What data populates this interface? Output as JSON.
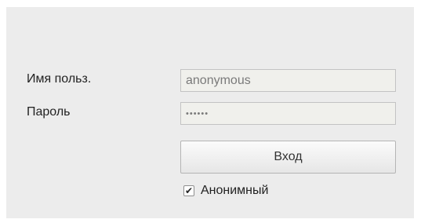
{
  "login_form": {
    "username_label": "Имя польз.",
    "username_value": "anonymous",
    "password_label": "Пароль",
    "password_value": "••••••",
    "login_button_label": "Вход",
    "anonymous_checkbox": {
      "label": "Анонимный",
      "checked": true,
      "check_glyph": "✔"
    }
  }
}
